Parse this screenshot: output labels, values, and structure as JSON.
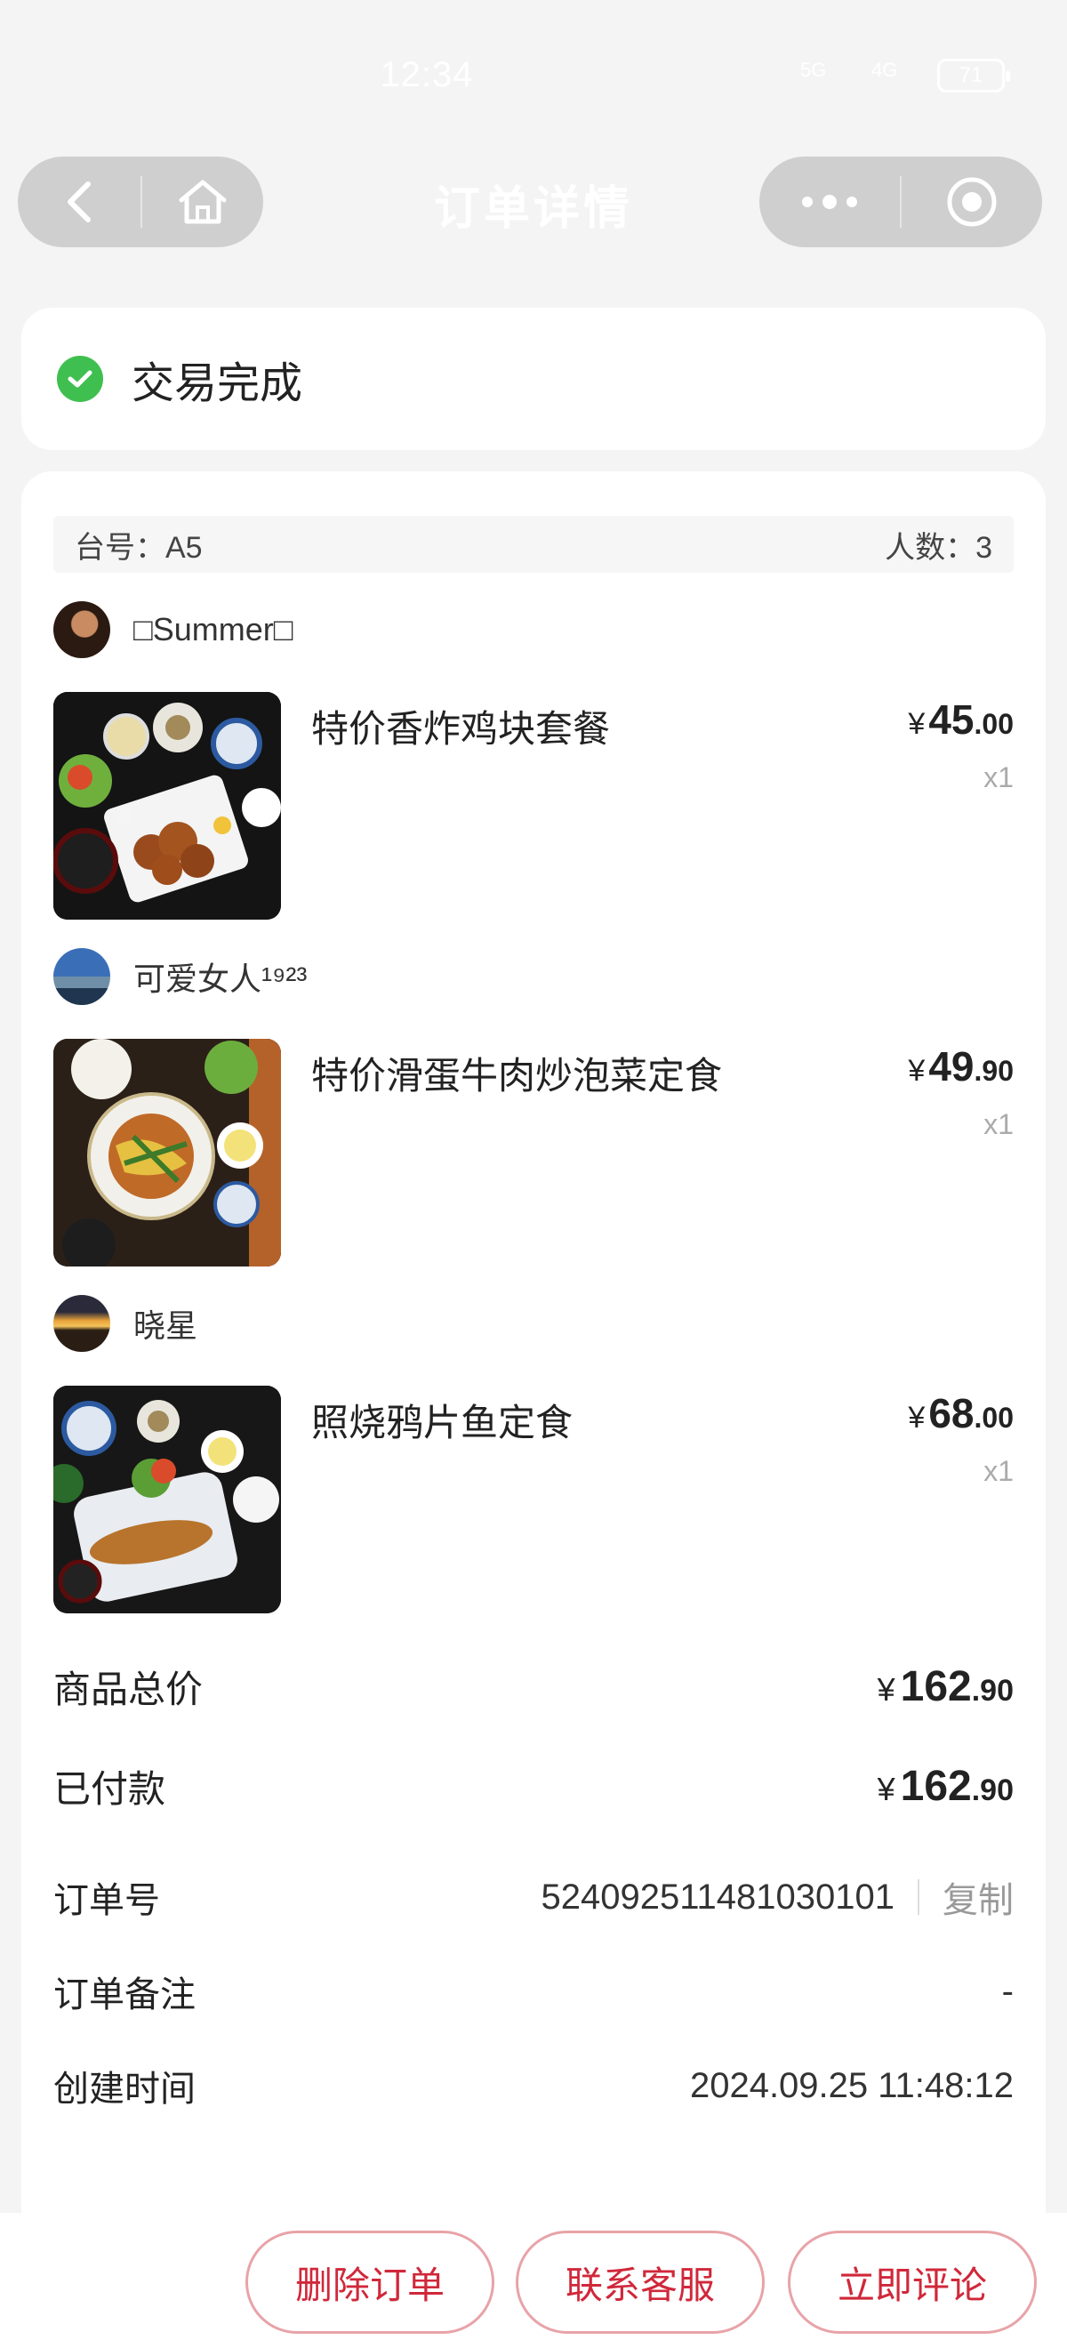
{
  "status_bar": {
    "time": "12:34",
    "signal_1": "5G",
    "signal_2": "4G",
    "battery": "71"
  },
  "nav": {
    "title": "订单详情"
  },
  "order_status": {
    "text": "交易完成"
  },
  "table": {
    "table_no": "台号：A5",
    "people": "人数：3"
  },
  "items": [
    {
      "diner": "□Summer□",
      "name": "特价香炸鸡块套餐",
      "price_int": "45",
      "price_dec": ".00",
      "currency": "¥",
      "qty": "x1"
    },
    {
      "diner": "可爱女人¹⁹²³",
      "name": "特价滑蛋牛肉炒泡菜定食",
      "price_int": "49",
      "price_dec": ".90",
      "currency": "¥",
      "qty": "x1"
    },
    {
      "diner": "晓星",
      "name": "照烧鸦片鱼定食",
      "price_int": "68",
      "price_dec": ".00",
      "currency": "¥",
      "qty": "x1"
    }
  ],
  "summary": {
    "total_label": "商品总价",
    "total_int": "162",
    "total_dec": ".90",
    "paid_label": "已付款",
    "paid_int": "162",
    "paid_dec": ".90",
    "currency": "¥"
  },
  "info": {
    "order_no_label": "订单号",
    "order_no": "524092511481030101",
    "copy": "复制",
    "remark_label": "订单备注",
    "remark": "-",
    "created_label": "创建时间",
    "created": "2024.09.25 11:48:12"
  },
  "actions": {
    "delete": "删除订单",
    "service": "联系客服",
    "review": "立即评论"
  },
  "colors": {
    "accent_red": "#d0283a",
    "success_green": "#3fbf4f"
  }
}
